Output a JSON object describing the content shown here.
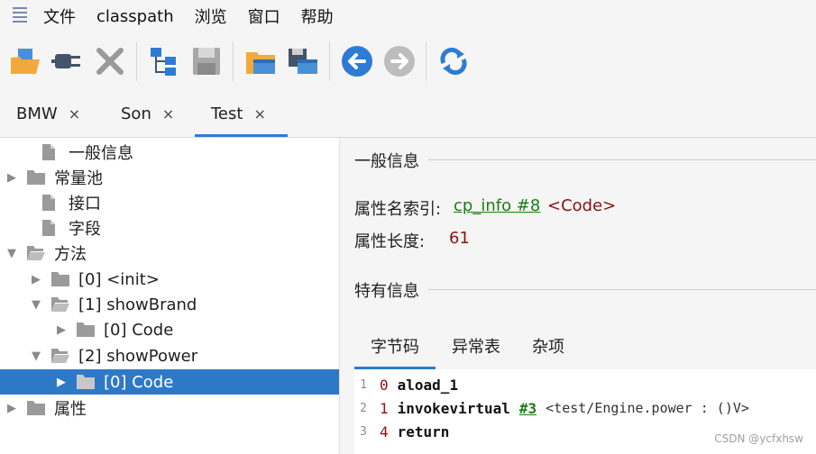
{
  "menu": {
    "items": [
      "文件",
      "classpath",
      "浏览",
      "窗口",
      "帮助"
    ]
  },
  "toolbar": {
    "buttons": [
      {
        "icon": "open-folder-icon",
        "color": "#f2a93b"
      },
      {
        "icon": "plug-icon",
        "color": "#44546a"
      },
      {
        "icon": "close-x-icon",
        "color": "#9a9a9a"
      },
      {
        "icon": "hierarchy-icon",
        "color": "#2d7bd4"
      },
      {
        "icon": "save-icon",
        "color": "#9a9a9a"
      },
      {
        "icon": "folder-window-icon",
        "color": "#f2a93b"
      },
      {
        "icon": "save-window-icon",
        "color": "#2d7bd4"
      },
      {
        "icon": "back-arrow-icon",
        "color": "#2d7bd4"
      },
      {
        "icon": "forward-arrow-icon",
        "color": "#bdbdbd"
      },
      {
        "icon": "refresh-icon",
        "color": "#2d7bd4"
      }
    ]
  },
  "tabs": [
    {
      "label": "BMW",
      "close": "×"
    },
    {
      "label": "Son",
      "close": "×"
    },
    {
      "label": "Test",
      "close": "×",
      "active": true
    }
  ],
  "tree": {
    "items": [
      {
        "label": "一般信息",
        "type": "doc",
        "expand": ""
      },
      {
        "label": "常量池",
        "type": "folder",
        "expand": "▶"
      },
      {
        "label": "接口",
        "type": "doc",
        "expand": ""
      },
      {
        "label": "字段",
        "type": "doc",
        "expand": ""
      },
      {
        "label": "方法",
        "type": "folder-open",
        "expand": "▼"
      },
      {
        "label": "[0] <init>",
        "type": "folder",
        "expand": "▶"
      },
      {
        "label": "[1] showBrand",
        "type": "folder-open",
        "expand": "▼"
      },
      {
        "label": "[0] Code",
        "type": "folder",
        "expand": "▶"
      },
      {
        "label": "[2] showPower",
        "type": "folder-open",
        "expand": "▼"
      },
      {
        "label": "[0] Code",
        "type": "folder",
        "expand": "▶",
        "selected": true
      },
      {
        "label": "属性",
        "type": "folder",
        "expand": "▶"
      }
    ]
  },
  "details": {
    "general_title": "一般信息",
    "name_index_label": "属性名索引:",
    "name_index_link": "cp_info #8",
    "name_index_value": "<Code>",
    "length_label": "属性长度:",
    "length_value": "61",
    "specific_title": "特有信息"
  },
  "inner_tabs": [
    "字节码",
    "异常表",
    "杂项"
  ],
  "bytecode": [
    {
      "line": "1",
      "offset": "0",
      "op": "aload_1",
      "ref": "",
      "comment": ""
    },
    {
      "line": "2",
      "offset": "1",
      "op": "invokevirtual",
      "ref": "#3",
      "comment": "<test/Engine.power : ()V>"
    },
    {
      "line": "3",
      "offset": "4",
      "op": "return",
      "ref": "",
      "comment": ""
    }
  ],
  "watermark": "CSDN @ycfxhsw",
  "colors": {
    "accent": "#2d7bd4",
    "selection": "#2e79c7",
    "link": "#1a7d12",
    "value": "#8b1111"
  }
}
